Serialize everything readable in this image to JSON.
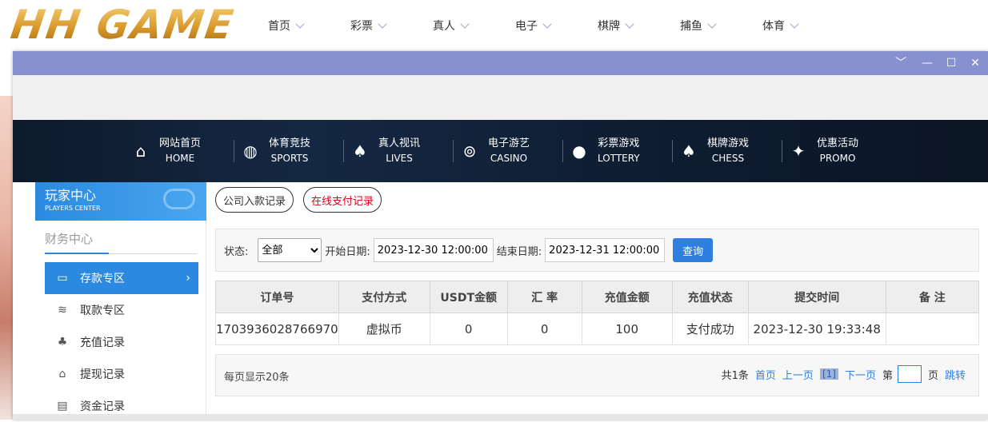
{
  "logo_text": "HH GAME",
  "top_nav": [
    "首页",
    "彩票",
    "真人",
    "电子",
    "棋牌",
    "捕鱼",
    "体育"
  ],
  "window_controls": {
    "collapse": "﹀",
    "minimize": "—",
    "maximize": "☐",
    "close": "✕"
  },
  "main_nav": [
    {
      "cn": "网站首页",
      "en": "HOME",
      "icon": "home-icon"
    },
    {
      "cn": "体育竞技",
      "en": "SPORTS",
      "icon": "basketball-icon"
    },
    {
      "cn": "真人视讯",
      "en": "LIVES",
      "icon": "cards-icon"
    },
    {
      "cn": "电子游艺",
      "en": "CASINO",
      "icon": "slot-icon"
    },
    {
      "cn": "彩票游戏",
      "en": "LOTTERY",
      "icon": "lottery-balls-icon"
    },
    {
      "cn": "棋牌游戏",
      "en": "CHESS",
      "icon": "spade-icon"
    },
    {
      "cn": "优惠活动",
      "en": "PROMO",
      "icon": "gift-icon"
    }
  ],
  "sidebar": {
    "title_cn": "玩家中心",
    "title_en": "PLAYERS CENTER",
    "section": "财务中心",
    "items": [
      {
        "label": "存款专区",
        "icon": "card-icon",
        "active": true
      },
      {
        "label": "取款专区",
        "icon": "cash-icon",
        "active": false
      },
      {
        "label": "充值记录",
        "icon": "money-bag-icon",
        "active": false
      },
      {
        "label": "提现记录",
        "icon": "withdraw-icon",
        "active": false
      },
      {
        "label": "资金记录",
        "icon": "ledger-icon",
        "active": false
      }
    ]
  },
  "tabs": [
    "公司入款记录",
    "在线支付记录"
  ],
  "filter": {
    "status_label": "状态:",
    "status_value": "全部",
    "start_label": "开始日期:",
    "start_value": "2023-12-30 12:00:00",
    "end_label": "结束日期:",
    "end_value": "2023-12-31 12:00:00",
    "query_label": "查询"
  },
  "table": {
    "headers": [
      "订单号",
      "支付方式",
      "USDT金额",
      "汇 率",
      "充值金额",
      "充值状态",
      "提交时间",
      "备 注"
    ],
    "rows": [
      [
        "1703936028766970",
        "虚拟币",
        "0",
        "0",
        "100",
        "支付成功",
        "2023-12-30 19:33:48",
        ""
      ]
    ]
  },
  "pager": {
    "per_page": "每页显示20条",
    "total": "共1条",
    "first": "首页",
    "prev": "上一页",
    "current": "[1]",
    "next": "下一页",
    "page_prefix": "第",
    "page_suffix": "页",
    "jump": "跳转"
  }
}
